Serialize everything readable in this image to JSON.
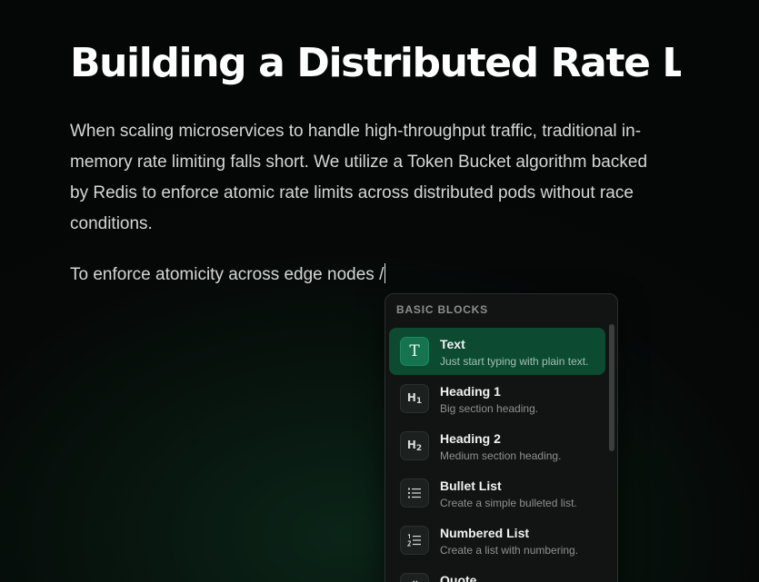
{
  "document": {
    "title": "Building a Distributed Rate Limiter",
    "paragraph": "When scaling microservices to handle high-throughput traffic, traditional in-memory rate limiting falls short. We utilize a Token Bucket algorithm backed by Redis to enforce atomic rate limits across distributed pods without race conditions.",
    "current_line": "To enforce atomicity across edge nodes /"
  },
  "slash_menu": {
    "header": "BASIC BLOCKS",
    "items": [
      {
        "title": "Text",
        "description": "Just start typing with plain text.",
        "icon": "text-icon",
        "selected": true
      },
      {
        "title": "Heading 1",
        "description": "Big section heading.",
        "icon": "heading-1-icon"
      },
      {
        "title": "Heading 2",
        "description": "Medium section heading.",
        "icon": "heading-2-icon"
      },
      {
        "title": "Bullet List",
        "description": "Create a simple bulleted list.",
        "icon": "bullet-list-icon"
      },
      {
        "title": "Numbered List",
        "description": "Create a list with numbering.",
        "icon": "numbered-list-icon"
      },
      {
        "title": "Quote",
        "description": "",
        "icon": "quote-icon"
      }
    ]
  },
  "colors": {
    "background": "#050606",
    "accent": "#0d4a32",
    "accent_icon": "#15744f",
    "menu_background": "#121414"
  }
}
